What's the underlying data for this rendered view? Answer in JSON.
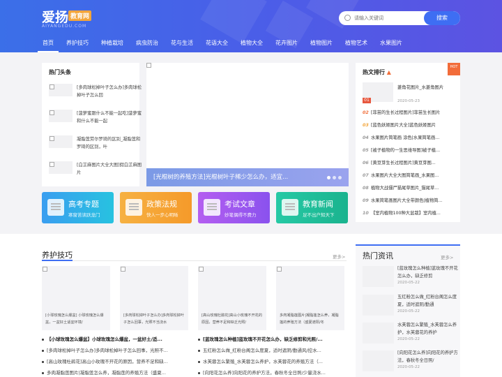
{
  "logo": {
    "cn": "爱扬",
    "badge": "教育网",
    "en": "AIYANGEDU.COM"
  },
  "search": {
    "placeholder": "请输入关键词",
    "button": "搜索"
  },
  "nav": [
    "首页",
    "养护技巧",
    "种植栽培",
    "病虫防治",
    "花与生活",
    "花语大全",
    "植物大全",
    "花卉图片",
    "植物图片",
    "植物艺术",
    "水果图片"
  ],
  "hot": {
    "title": "热门头条",
    "items": [
      "[多肉球松掉叶子怎么办]多肉球松掉叶子怎么回",
      "[菠萝蜜跟什么不能一起吃]菠萝蜜和什么不能一起",
      "凝脂莲劳尔罗琦的区别_凝脂莲和罗琦的区别，叶",
      "[白芷麻图片大全大图]假白芷麻图片"
    ]
  },
  "slider": {
    "caption": "[光棍树的养殖方法]光棍树叶子稀少怎么办，适宜..."
  },
  "rank": {
    "title": "热文排行",
    "badge": "HOT",
    "first": {
      "num": "01",
      "text": "菱角花图片_水菱角图片",
      "date": "2020-05-23"
    },
    "items": [
      {
        "num": "02",
        "text": "[菲苗的生长过程图片]菲苗生长图片"
      },
      {
        "num": "03",
        "text": "[蓝色妖姬图片大全]蓝色妖姬图片"
      },
      {
        "num": "04",
        "text": "水果图片简笔画 涂色|水果简笔画..."
      },
      {
        "num": "05",
        "text": "[被子植物的一生思维导图]被子植..."
      },
      {
        "num": "06",
        "text": "[黄豆芽生长过程图片]黄豆芽图..."
      },
      {
        "num": "07",
        "text": "水果图片大全大图简笔画_水果图..."
      },
      {
        "num": "08",
        "text": "植物大战僵尸猫尾草图片_猫尾草..."
      },
      {
        "num": "09",
        "text": "水果简笔画图片大全带颜色|植物简..."
      },
      {
        "num": "10",
        "text": "【室内植物100种大盆栽】室内植..."
      }
    ]
  },
  "categories": [
    {
      "title": "高考专题",
      "sub": "寒窗苦读跃龙门",
      "c1": "#3a9ef0",
      "c2": "#27c2e0"
    },
    {
      "title": "政策法规",
      "sub": "快人一步心明晰",
      "c1": "#f6b142",
      "c2": "#f59a2a"
    },
    {
      "title": "考试文章",
      "sub": "妙笔偶得不费力",
      "c1": "#b45ef0",
      "c2": "#8a52ee"
    },
    {
      "title": "教育新闻",
      "sub": "足不出户知天下",
      "c1": "#26c9a5",
      "c2": "#1ab38e"
    }
  ],
  "care": {
    "title": "养护技巧",
    "more": "更多>",
    "cards": [
      "[小球玫瑰怎么爆盆] 小球玫瑰怎么爆盆，一盆好土适宜环境/",
      "[多肉球松掉叶子怎么办]多肉球松掉叶子怎么回事，光照不当浇水",
      "[高山玫瑰杜鹃花]高山小玫瑰不开花的原因，营养不足和缺乏光照/",
      "多肉凝脂莲图片|凝脂莲怎么养，凝脂莲的养殖方法（盛夏遮阳/冬"
    ],
    "list_left": [
      "【小球玫瑰怎么爆盆】小球玫瑰怎么爆盆，一盆好土/适...",
      "[多肉球松掉叶子怎么办]多肉球松掉叶子怎么回事，光照不...",
      "[高山玫瑰杜鹃花]高山小玫瑰不开花的原因，营养不足和缺...",
      "多肉凝脂莲图片|凝脂莲怎么养，凝脂莲的养殖方法（盛夏..."
    ],
    "list_right": [
      "[蓝玫瑰怎么种植]蓝玫瑰不开花怎么办，缺乏修剪和光照/...",
      "五红粉怎么做_红粉台阁怎么度夏，适时遮阴/勤通风/控水...",
      "水芙蓉怎么繁殖_水芙蓉怎么养护，水芙蓉花的养殖方法（...",
      "[向阳花怎么养]向阳花的养护方法，春秋冬全日照/少量浇水..."
    ]
  },
  "news": {
    "title": "热门资讯",
    "more": "更多>",
    "items": [
      {
        "text": "[蓝玫瑰怎么种植]蓝玫瑰不开花怎么办，缺乏修剪",
        "date": "2020-05-22"
      },
      {
        "text": "五红粉怎么做_红粉台阁怎么度夏，适时遮阴/勤通",
        "date": "2020-05-22"
      },
      {
        "text": "水芙蓉怎么繁殖_水芙蓉怎么养护，水芙蓉花的养护",
        "date": "2020-05-22"
      },
      {
        "text": "[向阳花怎么养]向阳花的养护方法，春秋冬全日照/",
        "date": "2020-05-22"
      }
    ]
  }
}
